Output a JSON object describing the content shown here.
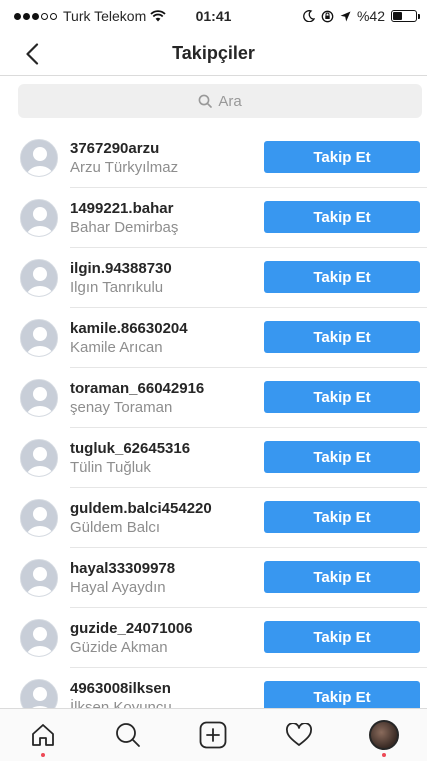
{
  "status_bar": {
    "carrier": "Turk Telekom",
    "time": "01:41",
    "battery": "%42",
    "battery_level": 0.42
  },
  "header": {
    "title": "Takipçiler",
    "back_icon": "chevron-left-icon"
  },
  "search": {
    "placeholder": "Ara",
    "icon": "search-icon"
  },
  "followers": [
    {
      "username": "3767290arzu",
      "name": "Arzu Türkyılmaz",
      "button": "Takip Et"
    },
    {
      "username": "1499221.bahar",
      "name": "Bahar Demirbaş",
      "button": "Takip Et"
    },
    {
      "username": "ilgin.94388730",
      "name": "Ilgın Tanrıkulu",
      "button": "Takip Et"
    },
    {
      "username": "kamile.86630204",
      "name": "Kamile Arıcan",
      "button": "Takip Et"
    },
    {
      "username": "toraman_66042916",
      "name": "şenay Toraman",
      "button": "Takip Et"
    },
    {
      "username": "tugluk_62645316",
      "name": "Tülin Tuğluk",
      "button": "Takip Et"
    },
    {
      "username": "guldem.balci454220",
      "name": "Güldem Balcı",
      "button": "Takip Et"
    },
    {
      "username": "hayal33309978",
      "name": "Hayal Ayaydın",
      "button": "Takip Et"
    },
    {
      "username": "guzide_24071006",
      "name": "Güzide Akman",
      "button": "Takip Et"
    },
    {
      "username": "4963008ilksen",
      "name": "İlksen Koyuncu",
      "button": "Takip Et"
    }
  ],
  "tabbar": {
    "tabs": [
      "home-icon",
      "search-icon",
      "add-icon",
      "heart-icon",
      "profile-avatar"
    ]
  },
  "colors": {
    "accent": "#3897f0",
    "notification_dot": "#ed4956"
  }
}
